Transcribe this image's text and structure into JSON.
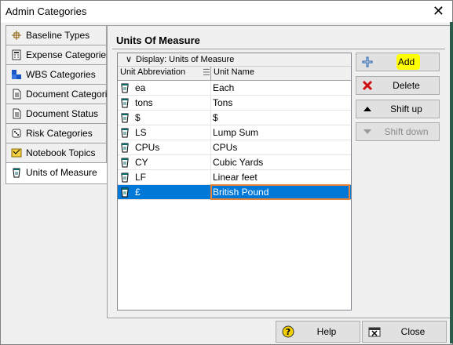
{
  "window": {
    "title": "Admin Categories",
    "close_glyph": "✕"
  },
  "sidebar": {
    "items": [
      {
        "label": "Baseline Types",
        "icon": "baseline-types-icon"
      },
      {
        "label": "Expense Categories",
        "icon": "expense-categories-icon"
      },
      {
        "label": "WBS Categories",
        "icon": "wbs-categories-icon"
      },
      {
        "label": "Document Categories",
        "icon": "document-categories-icon"
      },
      {
        "label": "Document Status",
        "icon": "document-status-icon"
      },
      {
        "label": "Risk Categories",
        "icon": "risk-categories-icon"
      },
      {
        "label": "Notebook Topics",
        "icon": "notebook-topics-icon"
      },
      {
        "label": "Units of Measure",
        "icon": "units-of-measure-icon",
        "active": true
      }
    ]
  },
  "panel": {
    "title": "Units Of Measure",
    "display_label": "Display: Units of Measure",
    "columns": {
      "abbr": "Unit Abbreviation",
      "name": "Unit Name"
    },
    "rows": [
      {
        "abbr": "ea",
        "name": "Each"
      },
      {
        "abbr": "tons",
        "name": "Tons"
      },
      {
        "abbr": "$",
        "name": "$"
      },
      {
        "abbr": "LS",
        "name": "Lump Sum"
      },
      {
        "abbr": "CPUs",
        "name": "CPUs"
      },
      {
        "abbr": "CY",
        "name": "Cubic Yards"
      },
      {
        "abbr": "LF",
        "name": "Linear feet"
      },
      {
        "abbr": "£",
        "name": "British Pound",
        "selected": true
      }
    ]
  },
  "actions": {
    "add": "Add",
    "delete": "Delete",
    "shift_up": "Shift up",
    "shift_down": "Shift down"
  },
  "footer": {
    "help": "Help",
    "close": "Close"
  },
  "colors": {
    "selection": "#0078d7",
    "edit_border": "#e8833a",
    "highlight": "#ffff00"
  }
}
